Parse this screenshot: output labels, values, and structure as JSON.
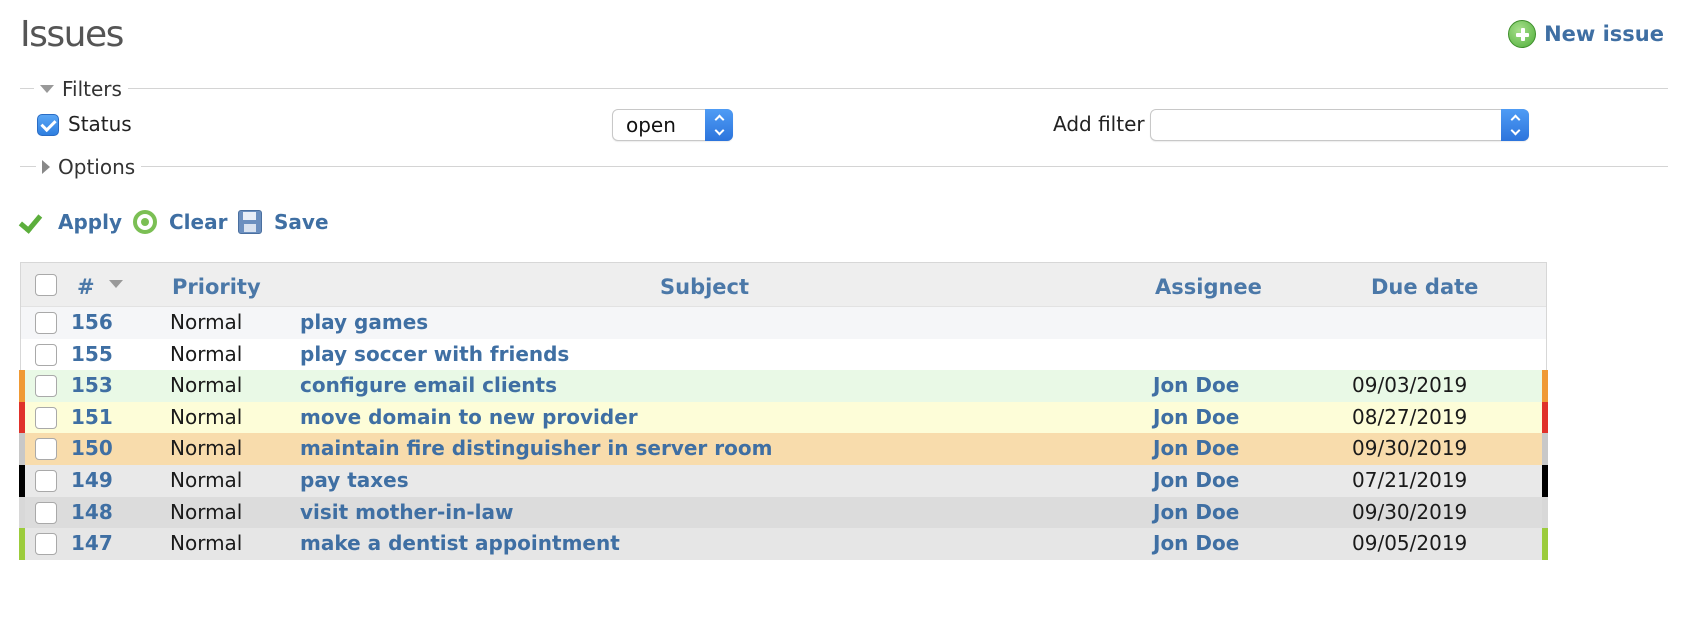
{
  "page": {
    "title": "Issues",
    "new_issue_label": "New issue"
  },
  "filters": {
    "legend": "Filters",
    "status_label": "Status",
    "status_checked": true,
    "status_operator": "open",
    "add_filter_label": "Add filter",
    "add_filter_value": ""
  },
  "options": {
    "legend": "Options"
  },
  "actions": {
    "apply": "Apply",
    "clear": "Clear",
    "save": "Save"
  },
  "table": {
    "columns": {
      "id": "#",
      "priority": "Priority",
      "subject": "Subject",
      "assignee": "Assignee",
      "due_date": "Due date"
    },
    "sort": {
      "column": "#",
      "direction": "descending"
    },
    "rows": [
      {
        "id": "156",
        "priority": "Normal",
        "subject": "play games",
        "assignee": "",
        "due_date": "",
        "bg": "#f5f6f8",
        "marker": ""
      },
      {
        "id": "155",
        "priority": "Normal",
        "subject": "play soccer with friends",
        "assignee": "",
        "due_date": "",
        "bg": "#ffffff",
        "marker": ""
      },
      {
        "id": "153",
        "priority": "Normal",
        "subject": "configure email clients",
        "assignee": "Jon Doe",
        "due_date": "09/03/2019",
        "bg": "#e9f9e6",
        "marker": "#f09a35"
      },
      {
        "id": "151",
        "priority": "Normal",
        "subject": "move domain to new provider",
        "assignee": "Jon Doe",
        "due_date": "08/27/2019",
        "bg": "#fdfdd8",
        "marker": "#e0312a"
      },
      {
        "id": "150",
        "priority": "Normal",
        "subject": "maintain fire distinguisher in server room",
        "assignee": "Jon Doe",
        "due_date": "09/30/2019",
        "bg": "#f8dcac",
        "marker": "#c8c8c8"
      },
      {
        "id": "149",
        "priority": "Normal",
        "subject": "pay taxes",
        "assignee": "Jon Doe",
        "due_date": "07/21/2019",
        "bg": "#e9e9e9",
        "marker": "#000000"
      },
      {
        "id": "148",
        "priority": "Normal",
        "subject": "visit mother-in-law",
        "assignee": "Jon Doe",
        "due_date": "09/30/2019",
        "bg": "#dcdcdc",
        "marker": "#d8d8d8"
      },
      {
        "id": "147",
        "priority": "Normal",
        "subject": "make a dentist appointment",
        "assignee": "Jon Doe",
        "due_date": "09/05/2019",
        "bg": "#e6e6e6",
        "marker": "#9ccc3c"
      }
    ]
  }
}
